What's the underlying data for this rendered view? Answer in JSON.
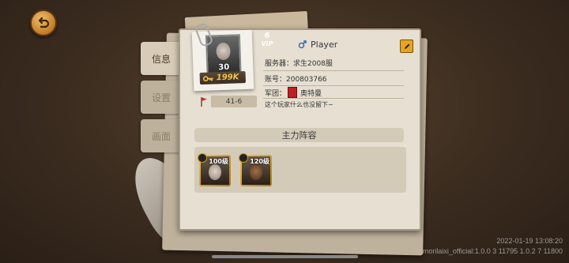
{
  "tabs": [
    {
      "label": "信息",
      "active": true
    },
    {
      "label": "设置",
      "active": false
    },
    {
      "label": "画面",
      "active": false
    }
  ],
  "profile": {
    "level": "30",
    "gold": "199K",
    "vip_level": "6",
    "vip_label": "VIP",
    "name": "Player",
    "server": "服务器：求生2008服",
    "account": "账号：200803766",
    "guild_label": "军团：",
    "guild_name": "奥特曼",
    "signature": "这个玩家什么也没留下~",
    "stage": "41-6"
  },
  "lineup": {
    "title": "主力阵容",
    "heroes": [
      {
        "level": "100级"
      },
      {
        "level": "120级"
      }
    ]
  },
  "watermark": {
    "timestamp": "2022-01-19 13:08:20",
    "version": "morilaixi_official:1.0.0 3 11795 1.0.2 7 11800"
  },
  "colors": {
    "accent": "#f3c048",
    "panel": "#e6dfd2"
  }
}
